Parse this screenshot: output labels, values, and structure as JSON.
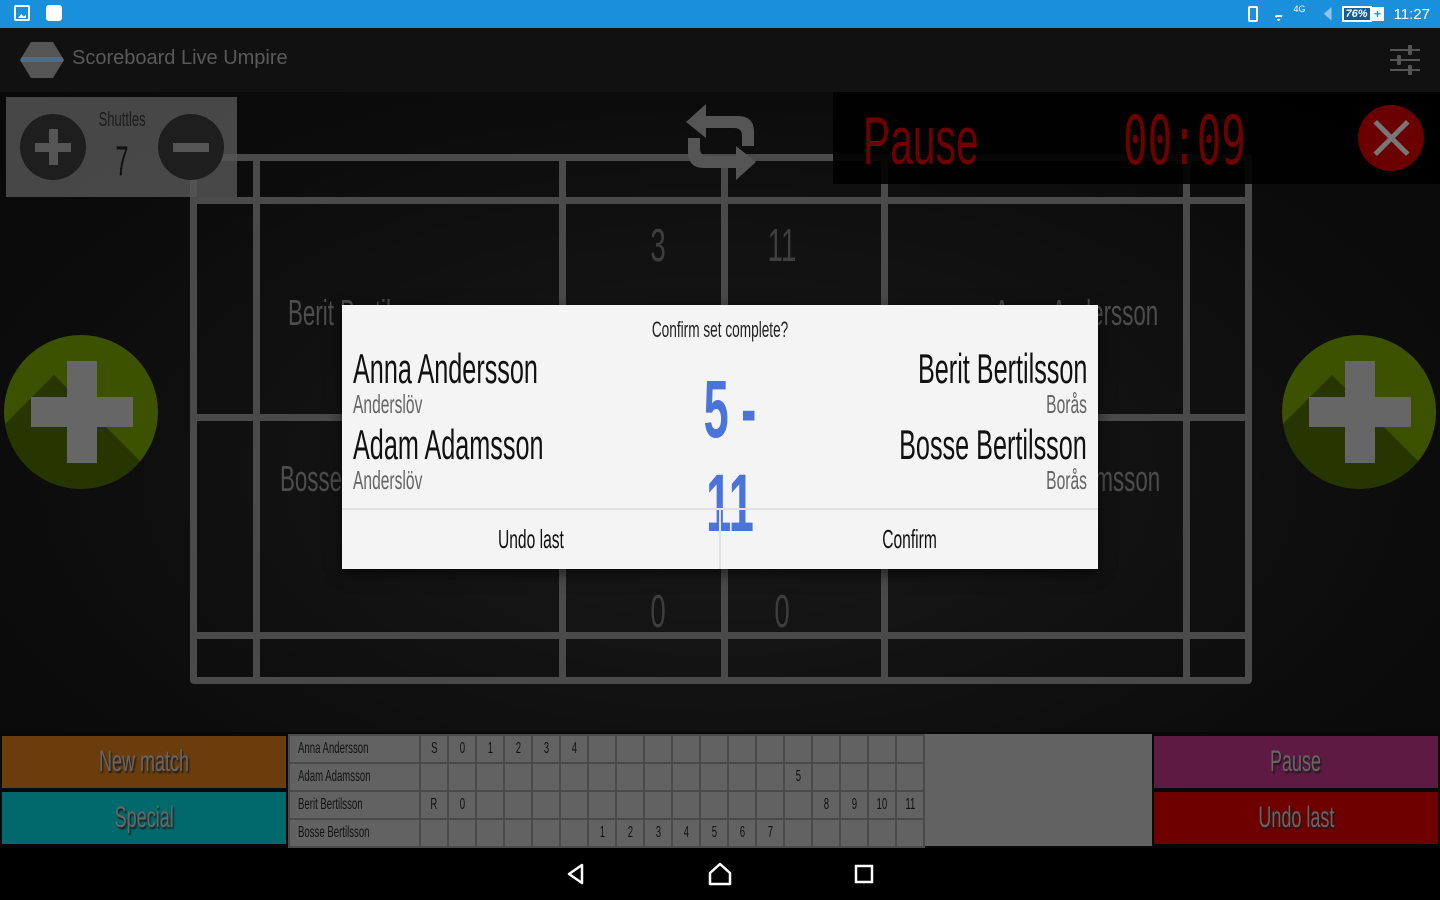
{
  "status_bar": {
    "notification_icons": [
      "image-icon",
      "clipboard-check-icon"
    ],
    "network": "4G",
    "battery": "76%",
    "time": "11:27"
  },
  "app_bar": {
    "title": "Scoreboard Live Umpire"
  },
  "shuttles": {
    "label": "Shuttles",
    "count": "7"
  },
  "timer": {
    "label": "Pause",
    "value": "00:09"
  },
  "court": {
    "top_left_name": "Berit Bertilsson",
    "bottom_left_name": "Bosse Bertilsson",
    "top_right_name": "Anna Andersson",
    "bottom_right_name": "Adam Adamsson",
    "top_left_score": "3",
    "top_right_score": "11",
    "bottom_left_score": "0",
    "bottom_right_score": "0"
  },
  "dialog": {
    "title": "Confirm set complete?",
    "left_team": [
      {
        "name": "Anna Andersson",
        "club": "Anderslöv"
      },
      {
        "name": "Adam Adamsson",
        "club": "Anderslöv"
      }
    ],
    "right_team": [
      {
        "name": "Berit Bertilsson",
        "club": "Borås"
      },
      {
        "name": "Bosse Bertilsson",
        "club": "Borås"
      }
    ],
    "score": "5 - 11",
    "undo_label": "Undo last",
    "confirm_label": "Confirm"
  },
  "actions": {
    "new_match": "New match",
    "special": "Special",
    "pause": "Pause",
    "undo_last": "Undo last"
  },
  "score_sheet": {
    "rows": [
      {
        "player": "Anna Andersson",
        "cells": [
          "S",
          "0",
          "1",
          "2",
          "3",
          "4",
          "",
          "",
          "",
          "",
          "",
          "",
          "",
          "",
          "",
          "",
          ""
        ]
      },
      {
        "player": "Adam Adamsson",
        "cells": [
          "",
          "",
          "",
          "",
          "",
          "",
          "",
          "",
          "",
          "",
          "",
          "",
          "",
          "5",
          "",
          "",
          ""
        ]
      },
      {
        "player": "Berit Bertilsson",
        "cells": [
          "R",
          "0",
          "",
          "",
          "",
          "",
          "",
          "",
          "",
          "",
          "",
          "",
          "",
          "",
          "8",
          "9",
          "10",
          "11"
        ]
      },
      {
        "player": "Bosse Bertilsson",
        "cells": [
          "",
          "",
          "",
          "",
          "",
          "",
          "1",
          "2",
          "3",
          "4",
          "5",
          "6",
          "7",
          "",
          "",
          "",
          ""
        ]
      }
    ]
  },
  "colors": {
    "status_bar": "#1a8fdb",
    "new_match": "#6b3d0c",
    "special": "#00696b",
    "pause": "#5e1a42",
    "undo_last": "#6e0000",
    "score_accent": "#4a74d9",
    "timer_red": "#6e0000",
    "add_point_green": "#3d5200"
  }
}
